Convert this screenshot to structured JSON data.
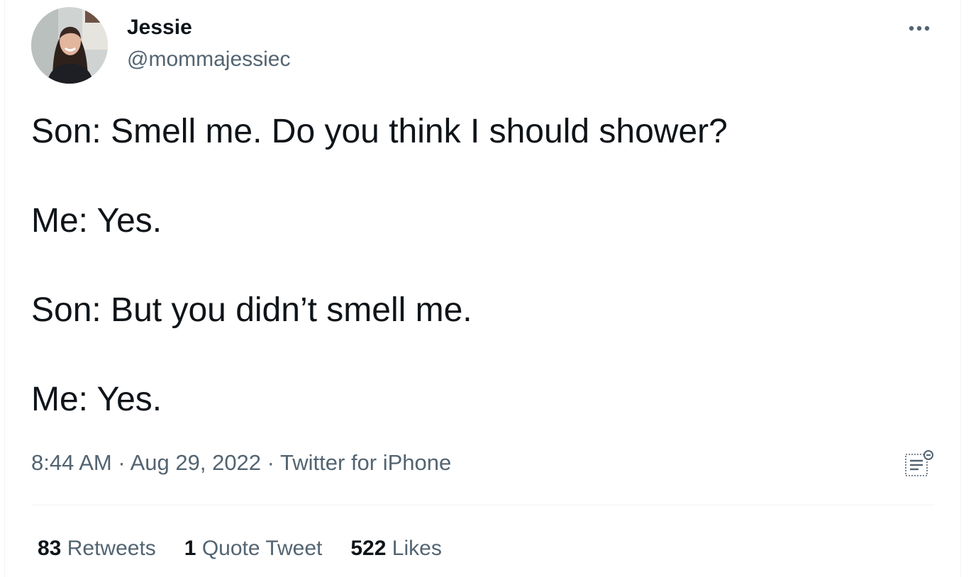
{
  "author": {
    "display_name": "Jessie",
    "handle": "@mommajessiec"
  },
  "tweet": {
    "lines": [
      "Son: Smell me. Do you think I should shower?",
      "Me: Yes.",
      "Son: But you didn’t smell me.",
      "Me: Yes."
    ]
  },
  "meta": {
    "time": "8:44 AM",
    "separator": " · ",
    "date": "Aug 29, 2022",
    "source": "Twitter for iPhone"
  },
  "stats": {
    "retweets": {
      "count": "83",
      "label": "Retweets"
    },
    "quotes": {
      "count": "1",
      "label": "Quote Tweet"
    },
    "likes": {
      "count": "522",
      "label": "Likes"
    }
  },
  "icons": {
    "more": "more-horizontal-icon",
    "analytics": "tweet-analytics-icon"
  },
  "colors": {
    "text_primary": "#0f1419",
    "text_secondary": "#536471",
    "divider": "#eff3f4"
  }
}
